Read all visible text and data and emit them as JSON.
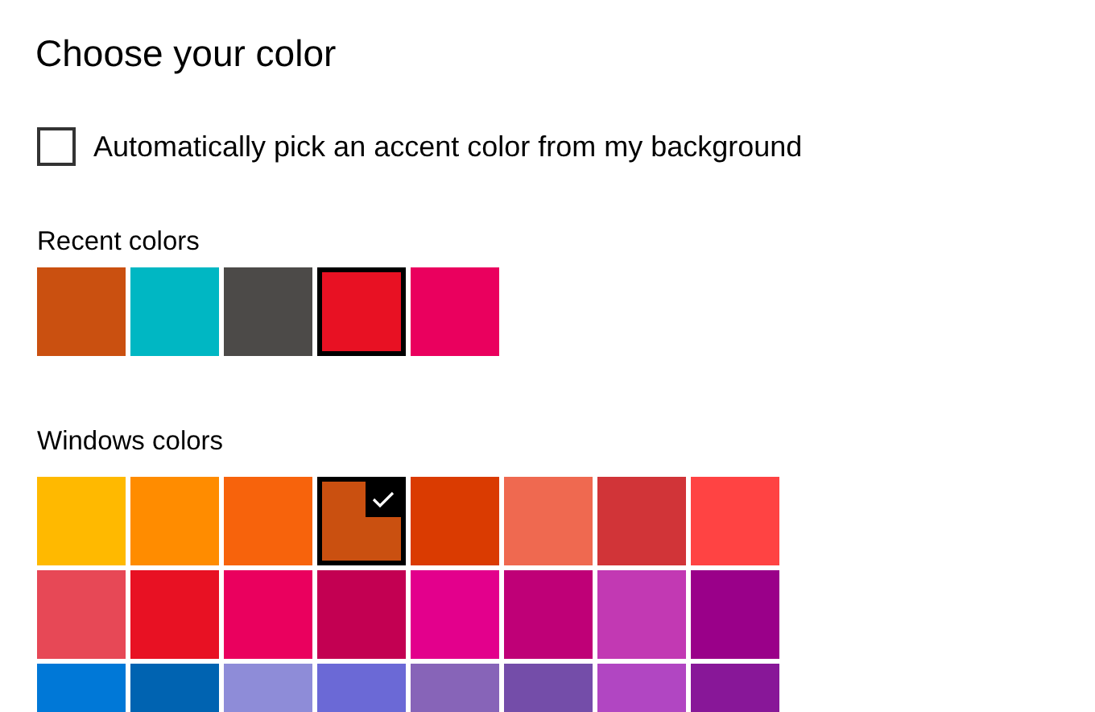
{
  "title": "Choose your color",
  "auto_pick": {
    "label": "Automatically pick an accent color from my background",
    "checked": false
  },
  "recent_colors": {
    "label": "Recent colors",
    "swatches": [
      {
        "color": "#ca5010",
        "selected": false
      },
      {
        "color": "#00b7c3",
        "selected": false
      },
      {
        "color": "#4c4a48",
        "selected": false
      },
      {
        "color": "#e81123",
        "selected": true
      },
      {
        "color": "#ea005e",
        "selected": false
      }
    ]
  },
  "windows_colors": {
    "label": "Windows colors",
    "swatches": [
      {
        "color": "#ffb900",
        "selected": false
      },
      {
        "color": "#ff8c00",
        "selected": false
      },
      {
        "color": "#f7630c",
        "selected": false
      },
      {
        "color": "#ca5010",
        "selected": true
      },
      {
        "color": "#da3b01",
        "selected": false
      },
      {
        "color": "#ef6950",
        "selected": false
      },
      {
        "color": "#d13438",
        "selected": false
      },
      {
        "color": "#ff4343",
        "selected": false
      },
      {
        "color": "#e74856",
        "selected": false
      },
      {
        "color": "#e81123",
        "selected": false
      },
      {
        "color": "#ea005e",
        "selected": false
      },
      {
        "color": "#c30052",
        "selected": false
      },
      {
        "color": "#e3008c",
        "selected": false
      },
      {
        "color": "#bf0077",
        "selected": false
      },
      {
        "color": "#c239b3",
        "selected": false
      },
      {
        "color": "#9a0089",
        "selected": false
      },
      {
        "color": "#0078d7",
        "selected": false
      },
      {
        "color": "#0063b1",
        "selected": false
      },
      {
        "color": "#8e8cd8",
        "selected": false
      },
      {
        "color": "#6b69d6",
        "selected": false
      },
      {
        "color": "#8764b8",
        "selected": false
      },
      {
        "color": "#744da9",
        "selected": false
      },
      {
        "color": "#b146c2",
        "selected": false
      },
      {
        "color": "#881798",
        "selected": false
      }
    ]
  }
}
